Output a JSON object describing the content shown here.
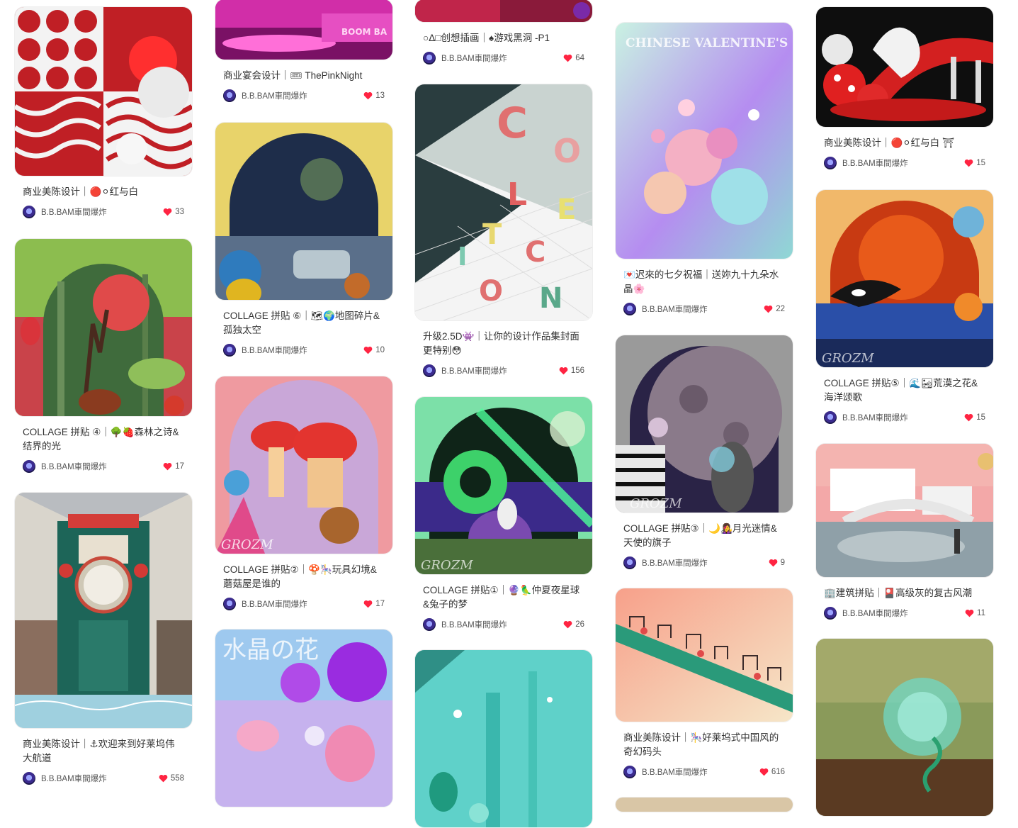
{
  "author": "B.B.BAM車間爆炸",
  "colors": {
    "heart": "#ff2442",
    "text": "#333333"
  },
  "columns": [
    {
      "cards": [
        {
          "title": "商业美陈设计｜🔴⚪红与白",
          "likes": "33",
          "art": "redwhite"
        },
        {
          "title": "COLLAGE 拼贴 ④｜🌳🍓森林之诗&结界的光",
          "likes": "17",
          "art": "forest"
        },
        {
          "title": "商业美陈设计｜⚓欢迎来到好莱坞伟大航道",
          "likes": "558",
          "art": "clock"
        }
      ]
    },
    {
      "cards": [
        {
          "title": "商业宴会设计｜🎟 ThePinkNight",
          "likes": "13",
          "art": "pinknight",
          "art_text": "BOOM BA"
        },
        {
          "title": "COLLAGE 拼贴 ⑥｜🗺🌍地图碎片&孤独太空",
          "likes": "10",
          "art": "space"
        },
        {
          "title": "COLLAGE 拼贴②｜🍄🎠玩具幻境&蘑菇屋是谁的",
          "likes": "17",
          "art": "mushroom",
          "art_text": "GROZM"
        },
        {
          "title": "",
          "likes": "",
          "art": "crystal",
          "art_text": "水晶の花"
        }
      ]
    },
    {
      "cards": [
        {
          "title": "○ᐃ□创想插画｜♠游戏黑洞 -P1",
          "likes": "64",
          "art": "game"
        },
        {
          "title": "升级2.5D👾｜让你的设计作品集封面更特别😳",
          "likes": "156",
          "art": "collection"
        },
        {
          "title": "COLLAGE 拼贴①｜🔮🦜仲夏夜星球&兔子的梦",
          "likes": "26",
          "art": "aurora",
          "art_text": "GROZM"
        },
        {
          "title": "",
          "likes": "",
          "art": "teal"
        }
      ]
    },
    {
      "cards": [
        {
          "title": "💌迟來的七夕祝福｜送妳九十九朵水晶🌸",
          "likes": "22",
          "art": "valentine",
          "art_text": "CHINESE VALENTINE'S DAY"
        },
        {
          "title": "COLLAGE 拼贴③｜🌙👩‍🎤月光迷情&天使的旗子",
          "likes": "9",
          "art": "moon",
          "art_text": "GROZM"
        },
        {
          "title": "商业美陈设计｜🎠好莱坞式中国风的奇幻码头",
          "likes": "616",
          "art": "bridge"
        }
      ]
    },
    {
      "cards": [
        {
          "title": "商业美陈设计｜🔴⚪红与白 ⛩",
          "likes": "15",
          "art": "redstage"
        },
        {
          "title": "COLLAGE 拼贴⑤｜🌊🏜荒漠之花&海洋颂歌",
          "likes": "15",
          "art": "ocean",
          "art_text": "GROZM"
        },
        {
          "title": "🏢建筑拼贴｜🎴高级灰的复古风潮",
          "likes": "11",
          "art": "architecture"
        },
        {
          "title": "",
          "likes": "",
          "art": "bubble"
        }
      ]
    }
  ]
}
